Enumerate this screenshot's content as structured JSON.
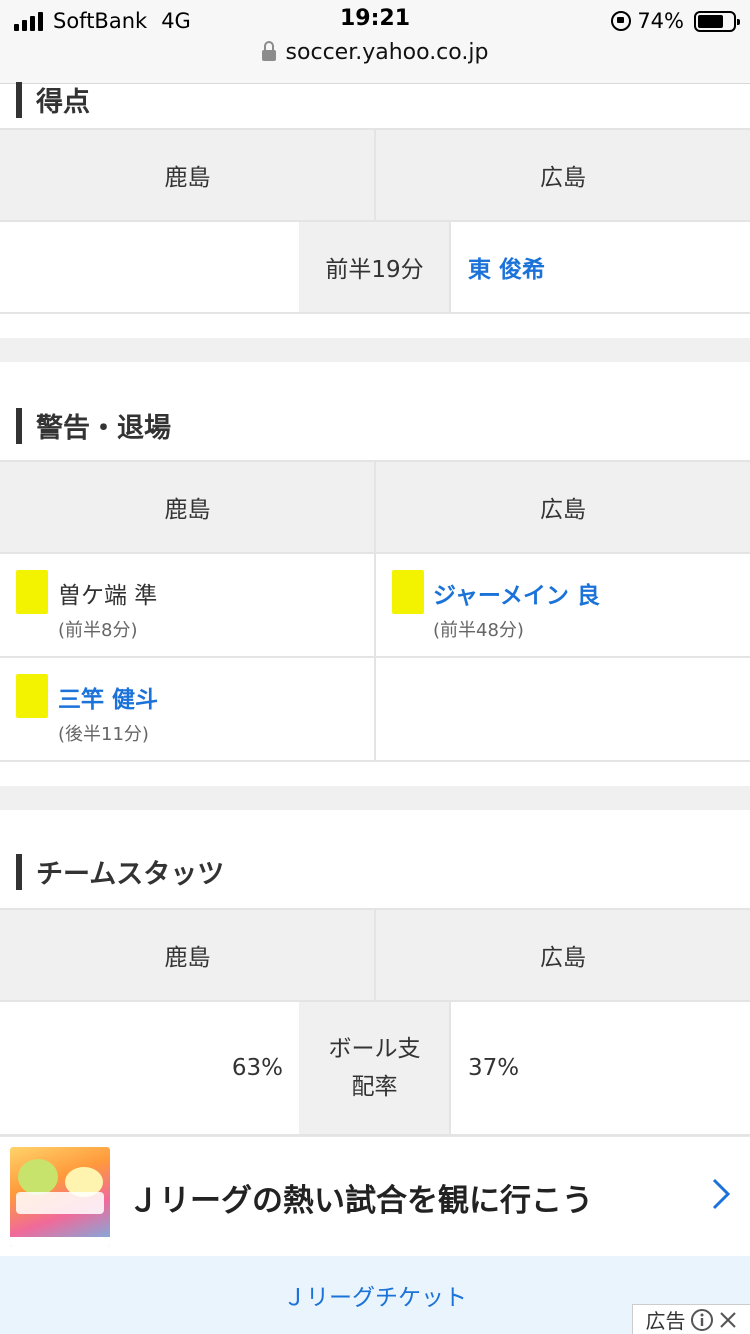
{
  "status_bar": {
    "carrier": "SoftBank",
    "network": "4G",
    "time": "19:21",
    "battery": "74%",
    "battery_level": 0.74,
    "url": "soccer.yahoo.co.jp"
  },
  "scoring": {
    "title": "得点",
    "home_team": "鹿島",
    "away_team": "広島",
    "goals": [
      {
        "home_player": "",
        "time": "前半19分",
        "away_player": "東 俊希"
      }
    ]
  },
  "cards": {
    "title": "警告・退場",
    "home_team": "鹿島",
    "away_team": "広島",
    "rows": [
      {
        "home": {
          "name": "曽ケ端 準",
          "time": "(前半8分)"
        },
        "away": {
          "name": "ジャーメイン 良",
          "time": "(前半48分)"
        }
      },
      {
        "home": {
          "name": "三竿 健斗",
          "time": "(後半11分)"
        },
        "away": null
      }
    ]
  },
  "stats": {
    "title": "チームスタッツ",
    "home_team": "鹿島",
    "away_team": "広島",
    "rows": [
      {
        "home": "63%",
        "label_line1": "ボール支",
        "label_line2": "配率",
        "away": "37%"
      }
    ]
  },
  "ad": {
    "title": "Ｊリーグの熱い試合を観に行こう",
    "cta": "Ｊリーグチケット",
    "tag": "広告",
    "colors": {
      "link": "#1b72d9",
      "cta_bg": "#eaf4fc",
      "yellow_card": "#f3f300"
    }
  }
}
